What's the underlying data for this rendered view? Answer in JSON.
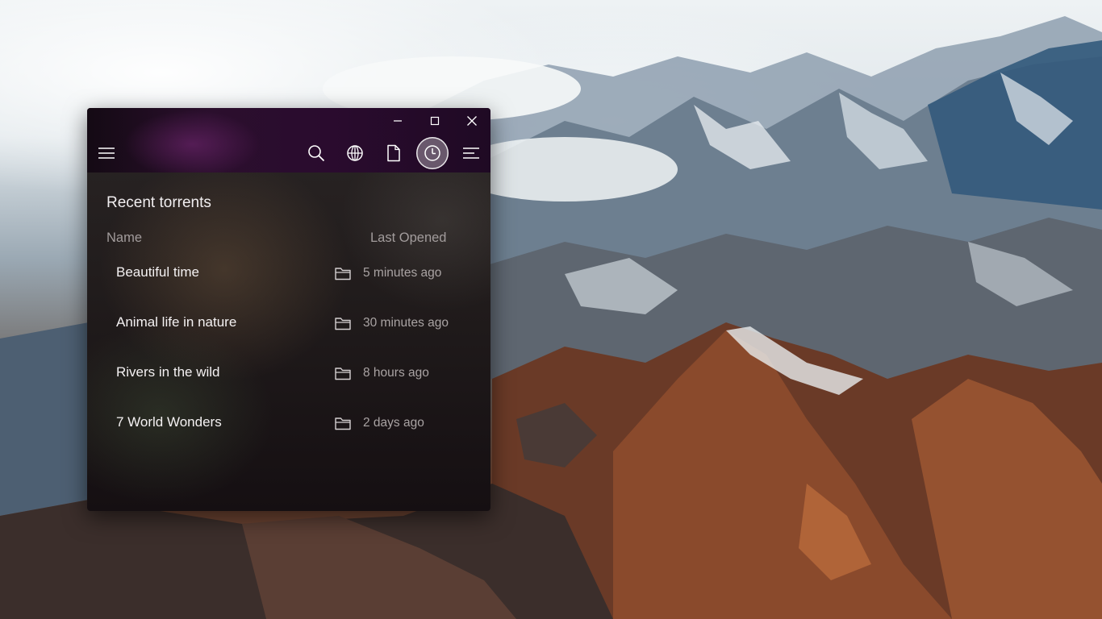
{
  "window": {
    "caption": {
      "minimize_icon": "minimize-icon",
      "maximize_icon": "maximize-icon",
      "close_icon": "close-icon"
    },
    "toolbar": {
      "menu_icon": "hamburger-icon",
      "items": [
        {
          "icon": "search-icon"
        },
        {
          "icon": "globe-icon"
        },
        {
          "icon": "file-icon"
        },
        {
          "icon": "clock-icon",
          "active": true
        },
        {
          "icon": "list-icon"
        }
      ]
    },
    "recent": {
      "title": "Recent torrents",
      "columns": {
        "name": "Name",
        "last_opened": "Last Opened"
      },
      "rows": [
        {
          "name": "Beautiful time",
          "last_opened": "5 minutes ago"
        },
        {
          "name": "Animal life in nature",
          "last_opened": "30 minutes ago"
        },
        {
          "name": "Rivers in the wild",
          "last_opened": "8 hours ago"
        },
        {
          "name": "7 World Wonders",
          "last_opened": "2 days ago"
        }
      ]
    }
  },
  "colors": {
    "header": "#2a0b2e",
    "text_primary": "#f4f1f2",
    "text_secondary": "#a9a3a3"
  }
}
